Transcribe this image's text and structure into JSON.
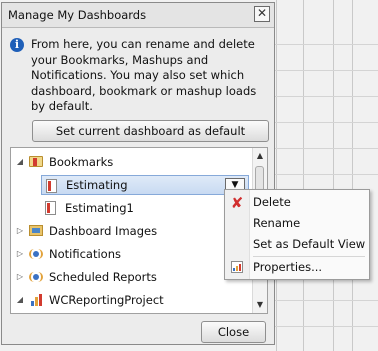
{
  "dialog": {
    "title": "Manage My Dashboards",
    "close_glyph": "✕",
    "info_text": "From here, you can rename and delete your Bookmarks, Mashups and Notifications.  You may also set which dashboard, bookmark or mashup loads by default.",
    "set_default_label": "Set current dashboard as default",
    "close_label": "Close"
  },
  "tree": {
    "items": [
      {
        "label": "Bookmarks",
        "icon": "folder-open-icon",
        "expanded": true
      },
      {
        "label": "Estimating",
        "icon": "dashboard-doc-icon",
        "selected": true
      },
      {
        "label": "Estimating1",
        "icon": "dashboard-doc-icon"
      },
      {
        "label": "Dashboard Images",
        "icon": "image-folder-icon"
      },
      {
        "label": "Notifications",
        "icon": "notification-icon"
      },
      {
        "label": "Scheduled Reports",
        "icon": "scheduled-report-icon"
      },
      {
        "label": "WCReportingProject",
        "icon": "project-chart-icon"
      }
    ]
  },
  "context_menu": {
    "items": [
      {
        "label": "Delete",
        "icon": "delete-x-icon"
      },
      {
        "label": "Rename"
      },
      {
        "label": "Set as Default View"
      },
      {
        "label": "Properties...",
        "icon": "properties-icon"
      }
    ]
  },
  "colors": {
    "selection": "#c8daf2",
    "accent": "#1f5fb8",
    "delete_red": "#d12f2f"
  }
}
